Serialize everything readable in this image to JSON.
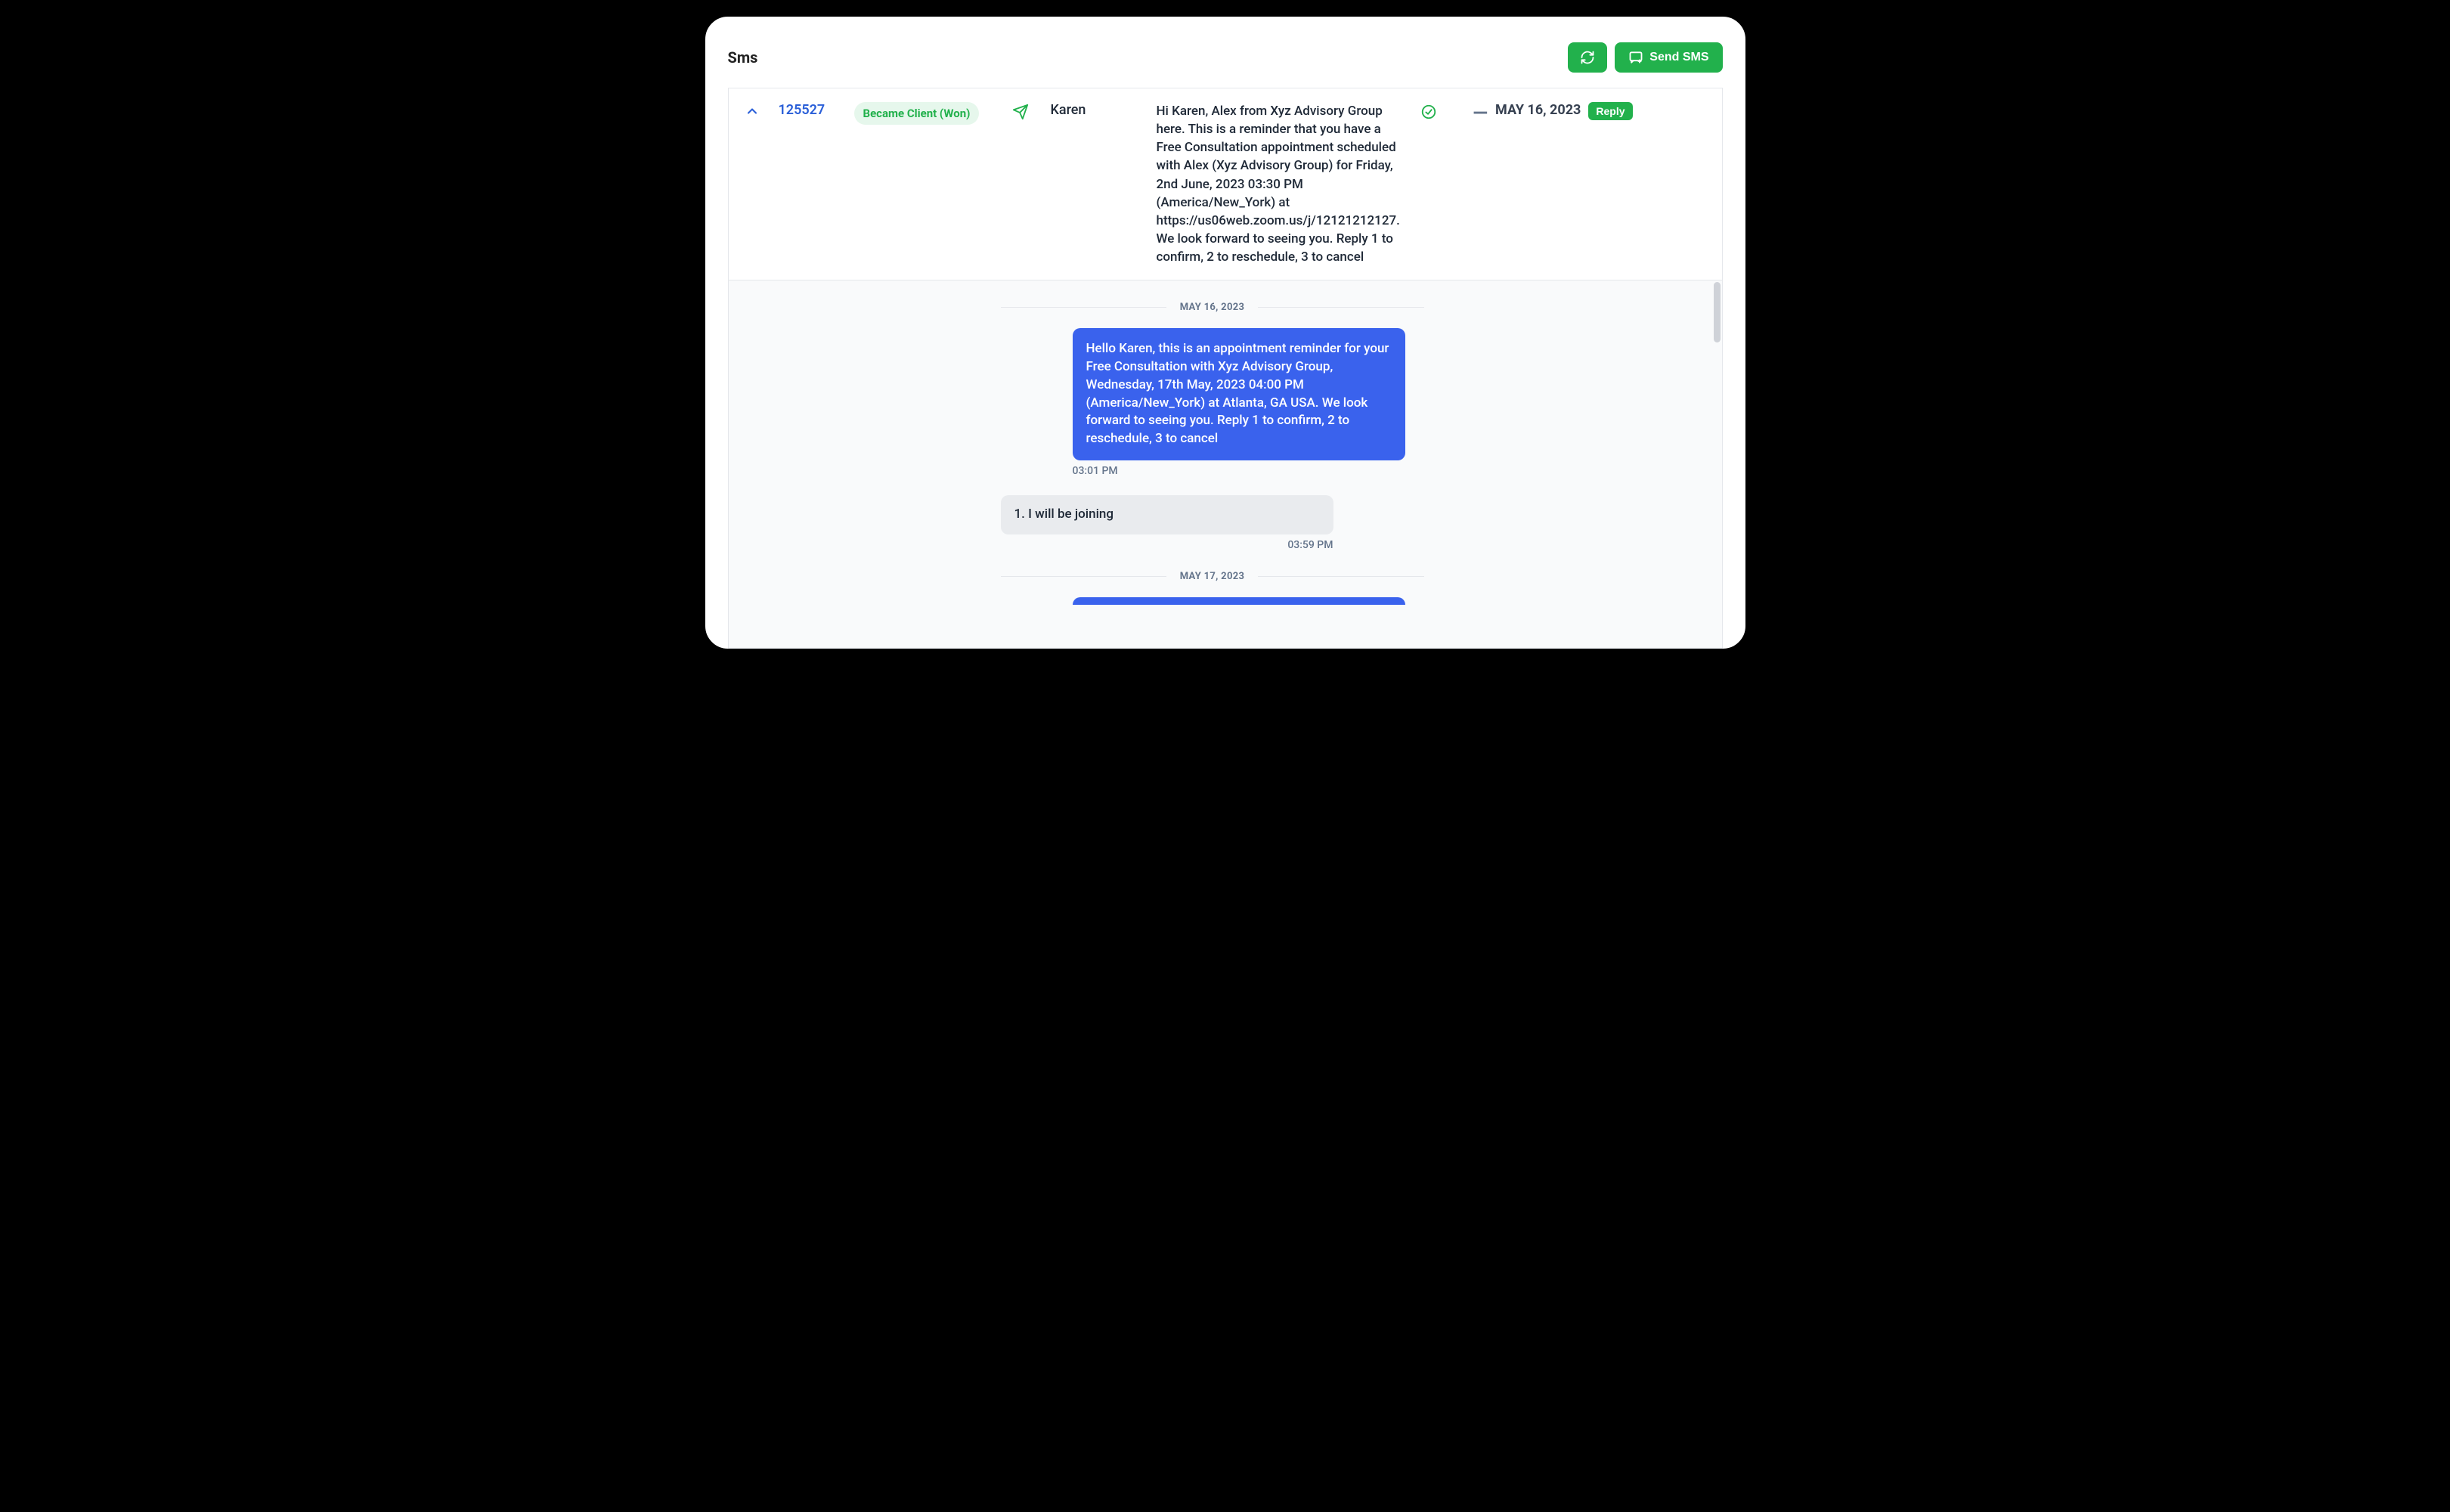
{
  "header": {
    "title": "Sms",
    "send_button": "Send SMS"
  },
  "row": {
    "id": "125527",
    "status": "Became Client (Won)",
    "name": "Karen",
    "message": "Hi Karen, Alex from Xyz Advisory Group here. This is a reminder that you have a Free Consultation appointment scheduled with Alex (Xyz Advisory Group) for Friday, 2nd June, 2023 03:30 PM (America/New_York) at https://us06web.zoom.us/j/12121212127. We look forward to seeing you. Reply 1 to confirm, 2 to reschedule, 3 to cancel",
    "dash": "—",
    "date": "MAY 16, 2023",
    "reply": "Reply"
  },
  "thread": {
    "sep1": "MAY 16, 2023",
    "out1": {
      "text": "Hello Karen, this is an appointment reminder for your Free Consultation with Xyz Advisory Group, Wednesday, 17th May, 2023 04:00 PM (America/New_York) at Atlanta, GA USA. We look forward to seeing you. Reply 1 to confirm, 2 to reschedule, 3 to cancel",
      "time": "03:01 PM"
    },
    "in1": {
      "text": "1. I will be joining",
      "time": "03:59 PM"
    },
    "sep2": "MAY 17, 2023"
  }
}
